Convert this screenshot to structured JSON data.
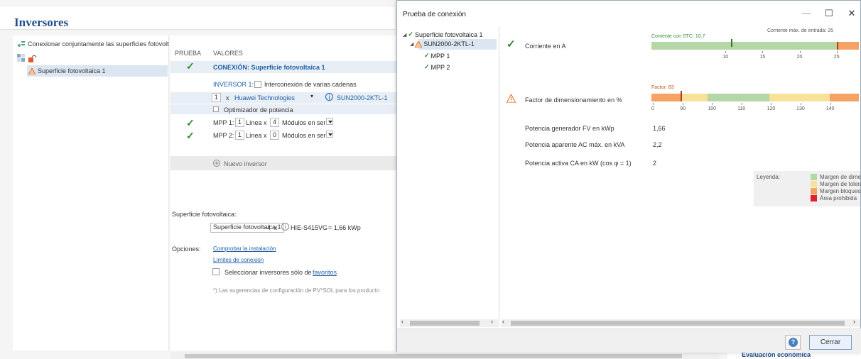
{
  "colors": {
    "green_margin": "#b5d6a7",
    "tolerance": "#f8e199",
    "blocked": "#f5a265",
    "forbidden": "#e0212a",
    "accent": "#1f4e8c",
    "check": "#2c8a2c"
  },
  "bg": {
    "title": "Inversores",
    "connect_jointly": "Conexionar conjuntamente las superficies fotovolt",
    "tree_item": "Superficie fotovoltaica 1",
    "col_test": "PRUEBA",
    "col_values": "VALORES",
    "connection_label": "CONEXIÓN: Superficie fotovoltaica 1",
    "inverter_label": "INVERSOR 1:",
    "multi_string": "Interconexión de varias cadenas",
    "inv_count": "1",
    "x": "x",
    "manufacturer": "Huawei Technologies",
    "model": "SUN2000-2KTL-1",
    "optimizer": "Optimizador de potencia",
    "mpp1_label": "MPP 1:",
    "mpp1_lines": "1",
    "mpp1_modules": "4",
    "mpp2_label": "MPP 2:",
    "mpp2_lines": "1",
    "mpp2_modules": "0",
    "line_x": "Línea x",
    "modules_series": "Módulos en serie",
    "new_inverter": "Nuevo inversor",
    "pv_area_label": "Superficie fotovoltaica:",
    "pv_area_value": "Superficie fotovoltaica 1",
    "pv_count": "4",
    "pv_module": "HIE-S415VG",
    "pv_power": "= 1,66 kWp",
    "options_label": "Opciones:",
    "check_install": "Comprobar la instalación",
    "conn_limits": "Límites de conexión",
    "select_favs": "Seleccionar inversores sólo de",
    "favorites": "favoritos",
    "footnote": "*) Las sugerencias de configuración de PV*SOL para los producto",
    "economic": "Evaluación económica"
  },
  "dialog": {
    "title": "Prueba de conexión",
    "tree": {
      "root": "Superficie fotovoltaica 1",
      "inverter": "SUN2000-2KTL-1",
      "mpp1": "MPP 1",
      "mpp2": "MPP 2"
    },
    "current": {
      "label": "Corriente en A",
      "stc_label": "Corriente con STC: 10.7",
      "max_label": "Corriente máx. de entrada: 25",
      "stc_value": 10.7,
      "max_value": 25,
      "axis_min": 0,
      "axis_max": 28,
      "ticks": [
        "10",
        "15",
        "20",
        "25"
      ]
    },
    "factor": {
      "label": "Factor de dimensionamiento en %",
      "factor_label": "Factor: 83",
      "value": 83,
      "ticks": [
        "0",
        "90",
        "100",
        "110",
        "120",
        "130",
        "140"
      ]
    },
    "gen_power_label": "Potencia generador FV en kWp",
    "gen_power_value": "1,66",
    "ac_power_label": "Potencia aparente AC máx. en kVA",
    "ac_power_value": "2,2",
    "active_power_label": "Potencia activa CA en kW (cos φ = 1)",
    "active_power_value": "2",
    "legend": {
      "title": "Leyenda:",
      "items": [
        "Margen de dimens.",
        "Margen de tolerancia",
        "Margen bloqueo",
        "Área prohibida"
      ]
    },
    "close_button": "Cerrar",
    "help_button": "?"
  }
}
